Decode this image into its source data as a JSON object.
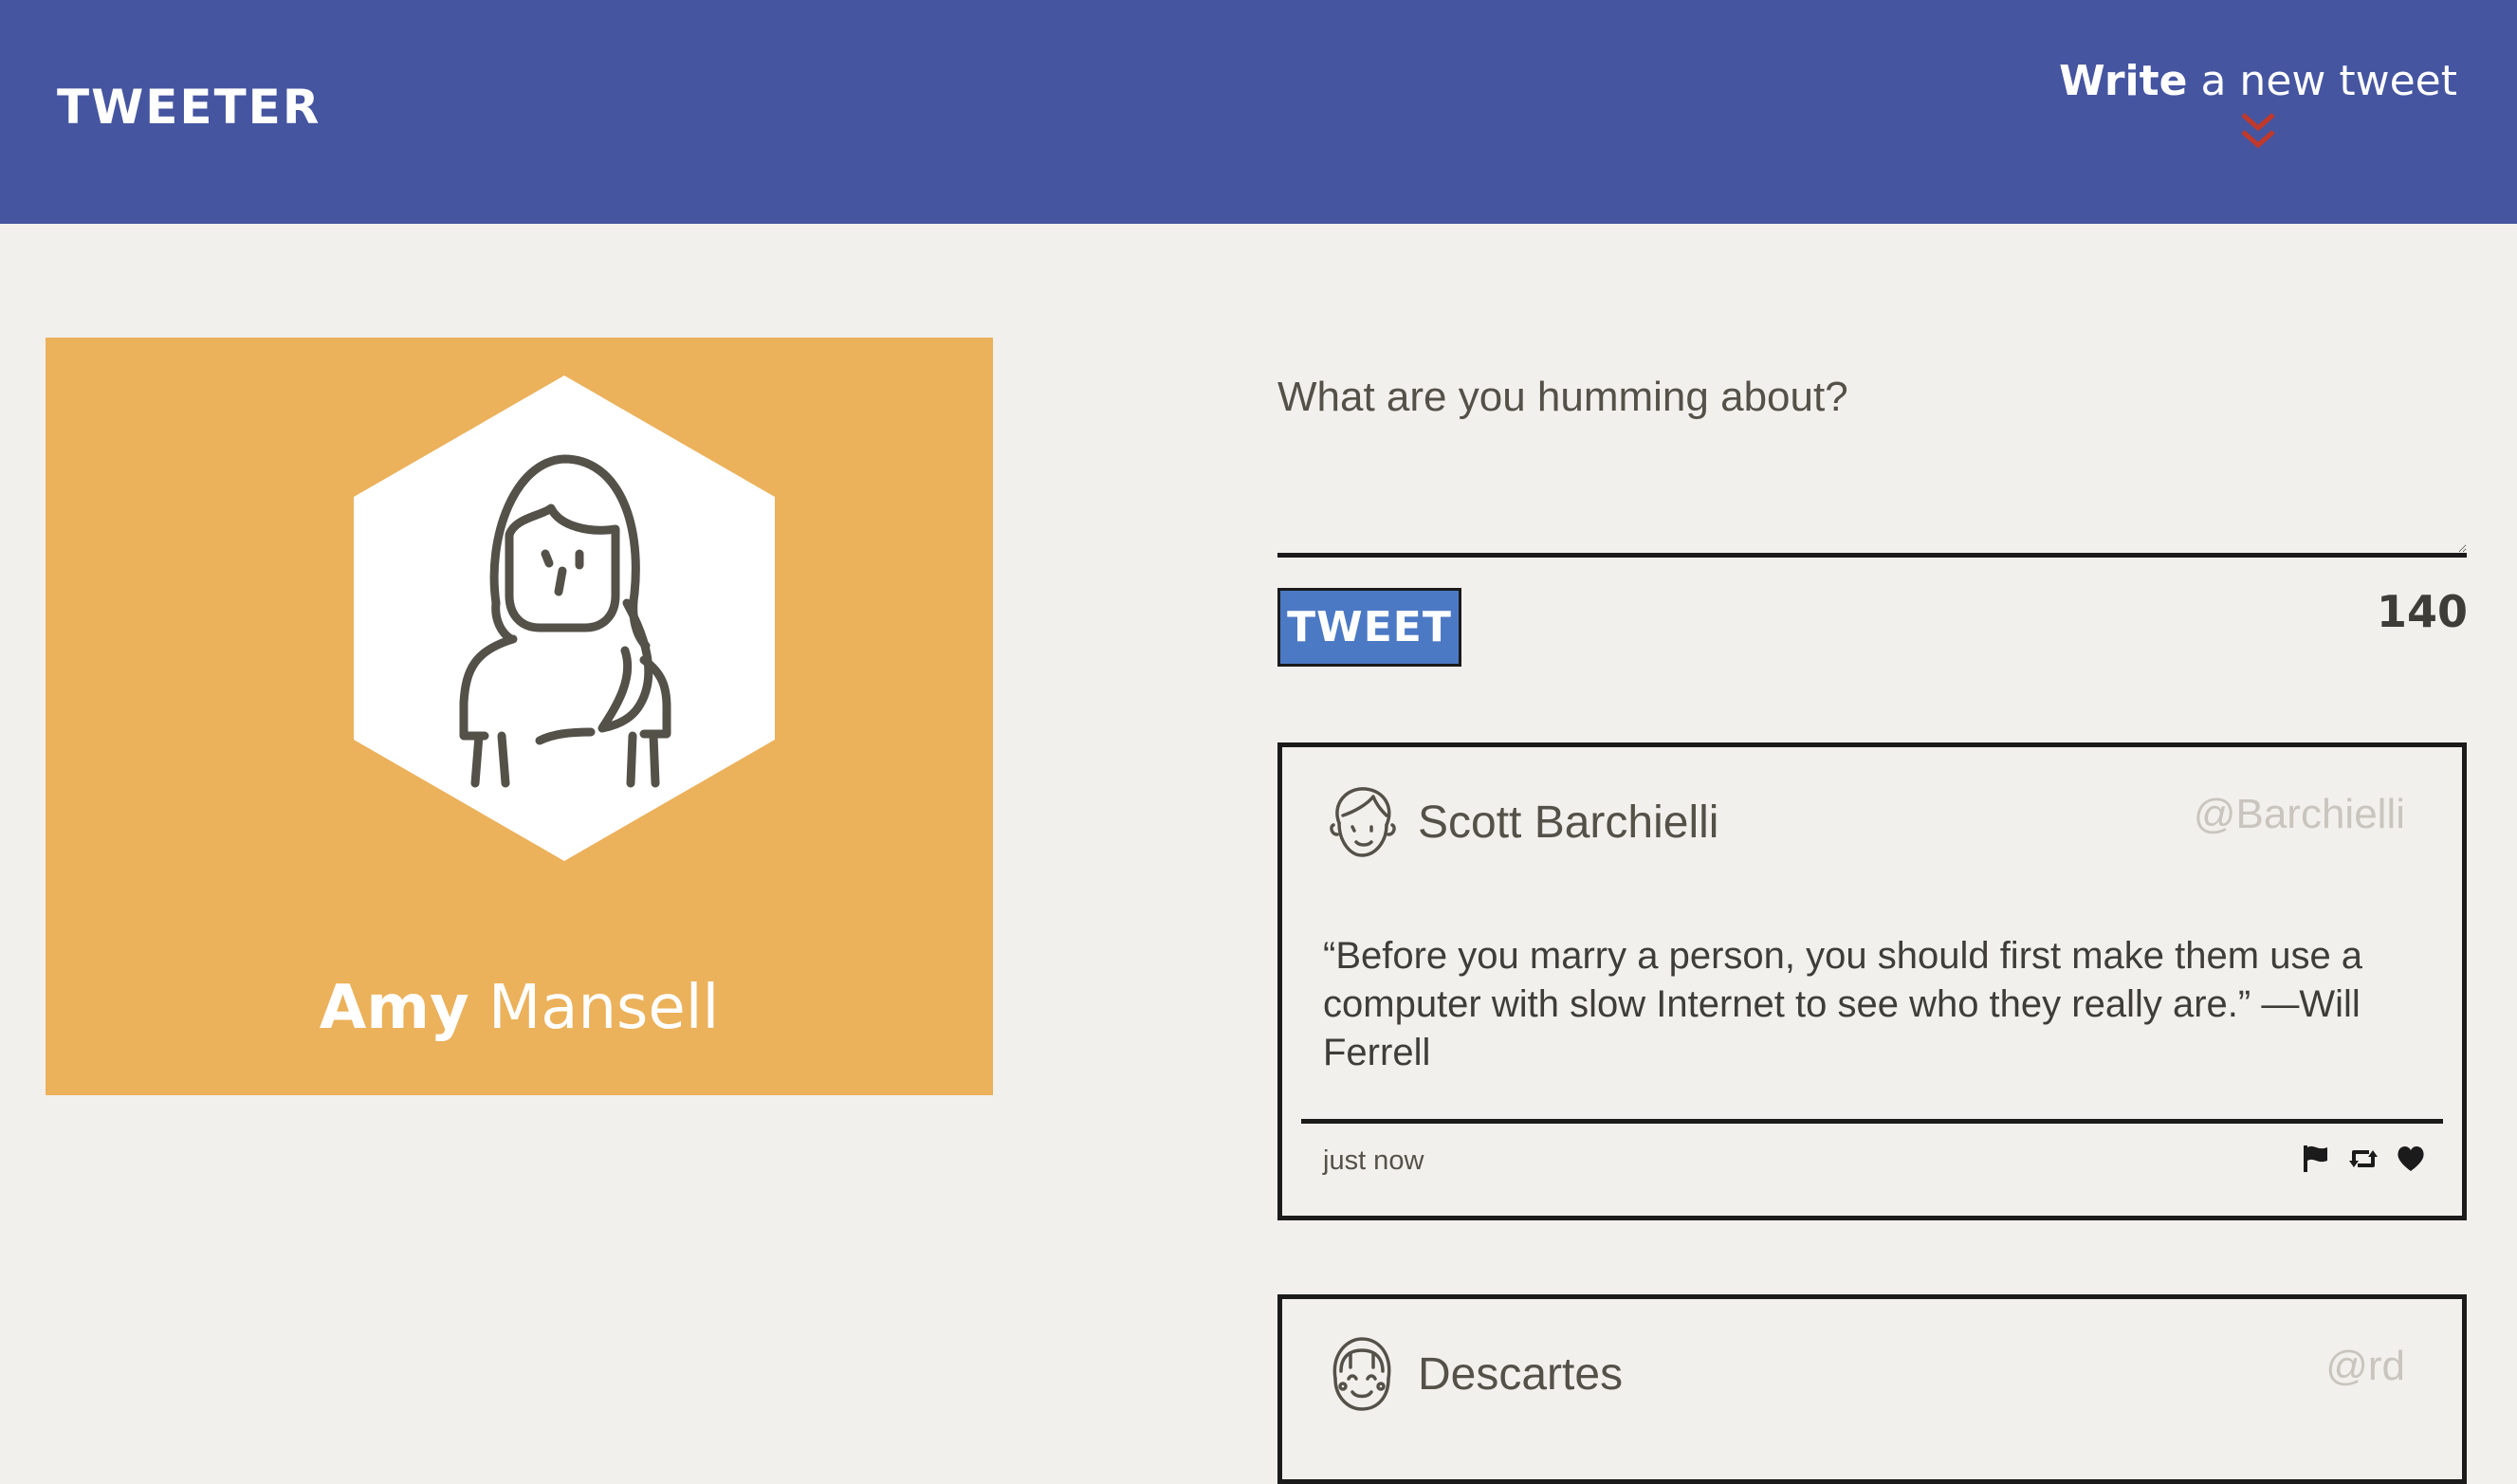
{
  "nav": {
    "brand": "TWEETER",
    "compose_bold": "Write",
    "compose_rest": " a new tweet",
    "compose_icon": "double-chevron-down-icon"
  },
  "profile": {
    "first_name": "Amy",
    "last_name": "Mansell",
    "avatar_icon": "woman-avatar-icon",
    "background_color": "#ebb15b"
  },
  "composer": {
    "placeholder": "What are you humming about?",
    "submit_label": "TWEET",
    "char_count": "140"
  },
  "tweets": [
    {
      "name": "Scott Barchielli",
      "handle": "@Barchielli",
      "text": "“Before you marry a person, you should first make them use a computer with slow Internet to see who they really are.” —Will Ferrell",
      "time": "just now",
      "avatar_icon": "man-avatar-icon",
      "actions": [
        "flag-icon",
        "retweet-icon",
        "heart-icon"
      ]
    },
    {
      "name": "Descartes",
      "handle": "@rd",
      "avatar_icon": "smiling-avatar-icon"
    }
  ],
  "colors": {
    "nav_bg": "#4555a0",
    "page_bg": "#f2f0ec",
    "accent_red": "#c0392b",
    "button_bg": "#4c79c4"
  }
}
